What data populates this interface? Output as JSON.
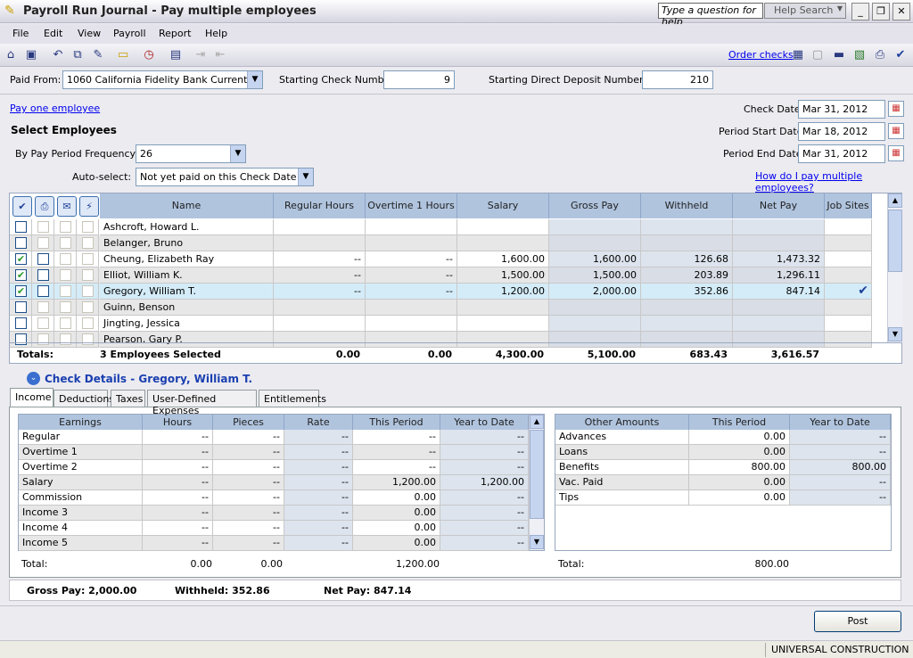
{
  "window": {
    "title": "Payroll Run Journal - Pay multiple employees",
    "help_placeholder": "Type a question for help",
    "help_search": "Help Search"
  },
  "menu": [
    "File",
    "Edit",
    "View",
    "Payroll",
    "Report",
    "Help"
  ],
  "toolbar": {
    "order_checks": "Order checks"
  },
  "form": {
    "paid_from_label": "Paid From:",
    "paid_from": "1060 California Fidelity Bank Current",
    "start_check_label": "Starting Check Number:",
    "start_check": "9",
    "start_dd_label": "Starting Direct Deposit Number: DD",
    "start_dd": "210",
    "pay_one": "Pay one employee",
    "select_employees": "Select Employees",
    "freq_label": "By Pay Period Frequency:",
    "freq": "26",
    "auto_label": "Auto-select:",
    "auto": "Not yet paid on this Check Date",
    "check_date_label": "Check Date:",
    "check_date": "Mar 31, 2012",
    "period_start_label": "Period Start Date:",
    "period_start": "Mar 18, 2012",
    "period_end_label": "Period End Date:",
    "period_end": "Mar 31, 2012",
    "how_link": "How do I pay multiple employees?"
  },
  "employees": {
    "columns": [
      "Name",
      "Regular Hours",
      "Overtime 1 Hours",
      "Salary",
      "Gross Pay",
      "Withheld",
      "Net Pay",
      "Job Sites"
    ],
    "rows": [
      {
        "name": "Ashcroft, Howard L.",
        "pay": false,
        "reg": "",
        "ot": "",
        "salary": "",
        "gross": "",
        "withheld": "",
        "net": "",
        "jobsites": false
      },
      {
        "name": "Belanger, Bruno",
        "pay": false,
        "reg": "",
        "ot": "",
        "salary": "",
        "gross": "",
        "withheld": "",
        "net": "",
        "jobsites": false
      },
      {
        "name": "Cheung, Elizabeth Ray",
        "pay": true,
        "reg": "--",
        "ot": "--",
        "salary": "1,600.00",
        "gross": "1,600.00",
        "withheld": "126.68",
        "net": "1,473.32",
        "jobsites": false
      },
      {
        "name": "Elliot, William K.",
        "pay": true,
        "reg": "--",
        "ot": "--",
        "salary": "1,500.00",
        "gross": "1,500.00",
        "withheld": "203.89",
        "net": "1,296.11",
        "jobsites": false
      },
      {
        "name": "Gregory, William T.",
        "pay": true,
        "reg": "--",
        "ot": "--",
        "salary": "1,200.00",
        "gross": "2,000.00",
        "withheld": "352.86",
        "net": "847.14",
        "jobsites": true
      },
      {
        "name": "Guinn, Benson",
        "pay": false,
        "reg": "",
        "ot": "",
        "salary": "",
        "gross": "",
        "withheld": "",
        "net": "",
        "jobsites": false
      },
      {
        "name": "Jingting, Jessica",
        "pay": false,
        "reg": "",
        "ot": "",
        "salary": "",
        "gross": "",
        "withheld": "",
        "net": "",
        "jobsites": false
      },
      {
        "name": "Pearson, Gary P.",
        "pay": false,
        "reg": "",
        "ot": "",
        "salary": "",
        "gross": "",
        "withheld": "",
        "net": "",
        "jobsites": false
      }
    ],
    "totals": {
      "label": "Totals:",
      "selected": "3 Employees Selected",
      "reg": "0.00",
      "ot": "0.00",
      "salary": "4,300.00",
      "gross": "5,100.00",
      "withheld": "683.43",
      "net": "3,616.57"
    }
  },
  "details": {
    "title": "Check Details - Gregory, William T.",
    "tabs": [
      "Income",
      "Deductions",
      "Taxes",
      "User-Defined Expenses",
      "Entitlements"
    ],
    "earnings_columns": [
      "Earnings",
      "Hours",
      "Pieces",
      "Rate",
      "This Period",
      "Year to Date"
    ],
    "earnings": [
      [
        "Regular",
        "--",
        "--",
        "--",
        "--",
        "--"
      ],
      [
        "Overtime 1",
        "--",
        "--",
        "--",
        "--",
        "--"
      ],
      [
        "Overtime 2",
        "--",
        "--",
        "--",
        "--",
        "--"
      ],
      [
        "Salary",
        "--",
        "--",
        "--",
        "1,200.00",
        "1,200.00"
      ],
      [
        "Commission",
        "--",
        "--",
        "--",
        "0.00",
        "--"
      ],
      [
        "Income 3",
        "--",
        "--",
        "--",
        "0.00",
        "--"
      ],
      [
        "Income 4",
        "--",
        "--",
        "--",
        "0.00",
        "--"
      ],
      [
        "Income 5",
        "--",
        "--",
        "--",
        "0.00",
        "--"
      ]
    ],
    "earnings_total": {
      "label": "Total:",
      "hours": "0.00",
      "pieces": "0.00",
      "period": "1,200.00"
    },
    "other_columns": [
      "Other Amounts",
      "This Period",
      "Year to Date"
    ],
    "other": [
      [
        "Advances",
        "0.00",
        "--"
      ],
      [
        "Loans",
        "0.00",
        "--"
      ],
      [
        "Benefits",
        "800.00",
        "800.00"
      ],
      [
        "Vac. Paid",
        "0.00",
        "--"
      ],
      [
        "Tips",
        "0.00",
        "--"
      ]
    ],
    "other_total": {
      "label": "Total:",
      "period": "800.00"
    }
  },
  "summary": {
    "gross": "Gross Pay: 2,000.00",
    "withheld": "Withheld: 352.86",
    "net": "Net Pay: 847.14"
  },
  "post": "Post",
  "status": "UNIVERSAL CONSTRUCTION"
}
